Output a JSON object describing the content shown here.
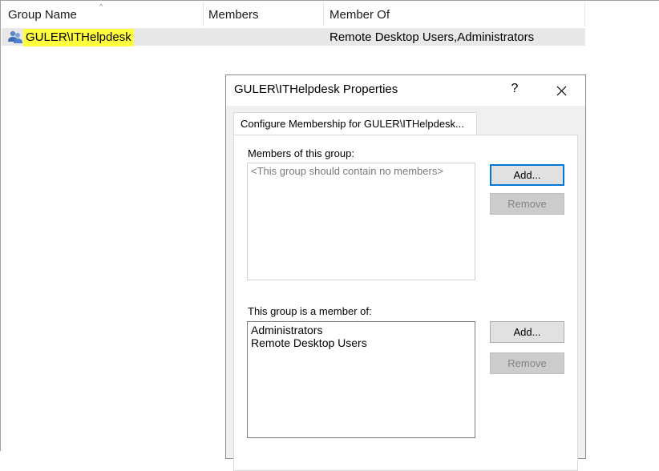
{
  "listview": {
    "columns": {
      "group_name": "Group Name",
      "members": "Members",
      "member_of": "Member Of"
    },
    "rows": [
      {
        "group_name": "GULER\\ITHelpdesk",
        "members": "",
        "member_of": "Remote Desktop Users,Administrators",
        "icon": "group-icon"
      }
    ]
  },
  "dialog": {
    "title": "GULER\\ITHelpdesk Properties",
    "help_label": "?",
    "tab_label": "Configure Membership for GULER\\ITHelpdesk...",
    "members_label": "Members of this group:",
    "members_placeholder": "<This group should contain no members>",
    "member_of_label": "This group is a member of:",
    "member_of_items": [
      "Administrators",
      "Remote Desktop Users"
    ],
    "add_label": "Add...",
    "remove_label": "Remove"
  },
  "colors": {
    "highlight": "#ffff3d",
    "focus_border": "#0078d7"
  }
}
